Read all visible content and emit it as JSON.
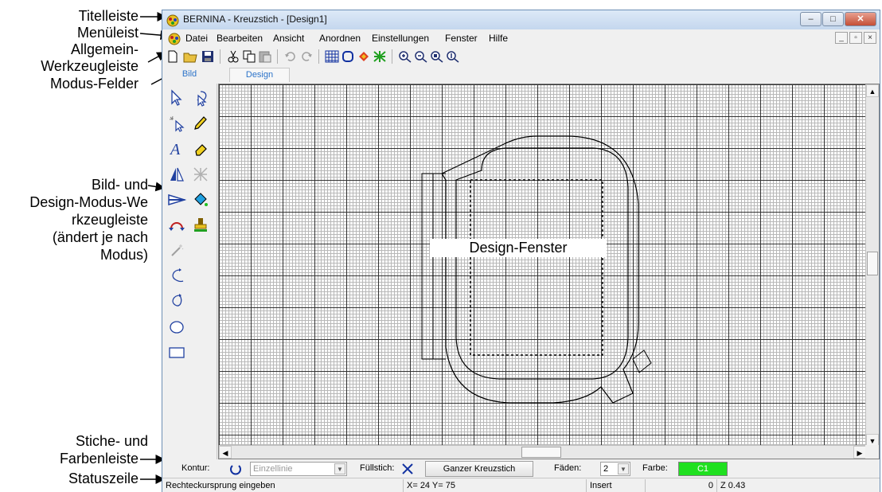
{
  "callouts": {
    "titelleiste": "Titelleiste",
    "menueleist": "Menüleist",
    "allgemein_1": "Allgemein-",
    "allgemein_2": "Werkzeugleiste",
    "modus_felder": "Modus-Felder",
    "bild_1": "Bild- und",
    "bild_2": "Design-Modus-We",
    "bild_3": "rkzeugleiste",
    "bild_4": "(ändert je nach",
    "bild_5": "Modus)",
    "stiche_1": "Stiche- und",
    "stiche_2": "Farbenleiste",
    "statuszeile": "Statuszeile"
  },
  "window": {
    "title": "BERNINA - Kreuzstich - [Design1]"
  },
  "menu": {
    "items": [
      "Datei",
      "Bearbeiten",
      "Ansicht",
      "Anordnen",
      "Einstellungen",
      "Fenster",
      "Hilfe"
    ]
  },
  "mode_tabs": {
    "bild": "Bild",
    "design": "Design"
  },
  "canvas": {
    "label": "Design-Fenster"
  },
  "stitchbar": {
    "kontur_label": "Kontur:",
    "kontur_value": "Einzellinie",
    "fuellstich_label": "Füllstich:",
    "fill_button": "Ganzer Kreuzstich",
    "faeden_label": "Fäden:",
    "faeden_value": "2",
    "farbe_label": "Farbe:",
    "farbe_value": "C1",
    "farbe_color": "#20e020"
  },
  "statusbar": {
    "message": "Rechteckursprung eingeben",
    "coords": "X= 24  Y= 75",
    "mode": "Insert",
    "count": "0",
    "zoom": "Z 0.43"
  },
  "colors": {
    "accent": "#2c73c9",
    "close_button": "#c44f37"
  }
}
